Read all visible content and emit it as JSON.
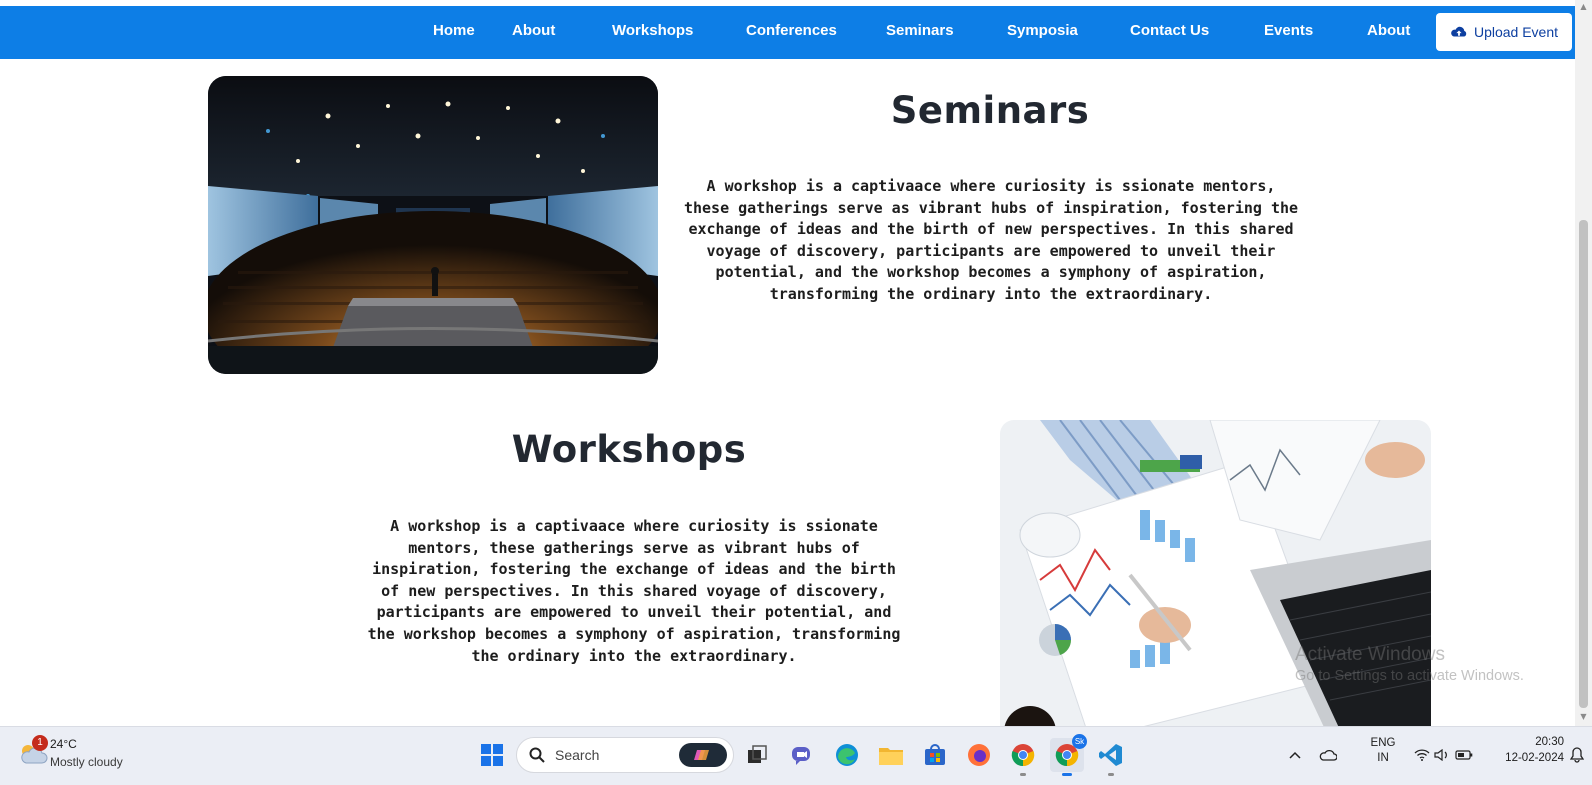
{
  "nav": {
    "links": [
      "Home",
      "About",
      "Workshops",
      "Conferences",
      "Seminars",
      "Symposia",
      "Contact Us",
      "Events",
      "About"
    ],
    "upload_label": "Upload Event"
  },
  "sections": {
    "seminars": {
      "title": "Seminars",
      "text": "A workshop is a captivaace where curiosity is ssionate mentors, these gatherings serve as vibrant hubs of inspiration, fostering the exchange of ideas and the birth of new perspectives. In this shared voyage of discovery, participants are empowered to unveil their potential, and the workshop becomes a symphony of aspiration, transforming the ordinary into the extraordinary."
    },
    "workshops": {
      "title": "Workshops",
      "text": "A workshop is a captivaace where curiosity is ssionate mentors, these gatherings serve as vibrant hubs of inspiration, fostering the exchange of ideas and the birth of new perspectives. In this shared voyage of discovery, participants are empowered to unveil their potential, and the workshop becomes a symphony of aspiration, transforming the ordinary into the extraordinary."
    }
  },
  "watermark": {
    "line1": "Activate Windows",
    "line2": "Go to Settings to activate Windows."
  },
  "taskbar": {
    "weather_badge": "1",
    "temperature": "24°C",
    "condition": "Mostly cloudy",
    "search_placeholder": "Search",
    "chrome_profile_badge": "Sk",
    "language": "ENG",
    "region": "IN",
    "time": "20:30",
    "date": "12-02-2024",
    "apps": [
      "start-icon",
      "copilot-icon",
      "task-view-icon",
      "teams-icon",
      "edge-icon",
      "file-explorer-icon",
      "microsoft-store-icon",
      "firefox-icon",
      "chrome-icon",
      "chrome-profile-icon",
      "vscode-icon"
    ]
  },
  "colors": {
    "navbar": "#0d7ee6",
    "title": "#222831",
    "body_text": "#1d1d1d",
    "taskbar": "#ebeef5"
  }
}
